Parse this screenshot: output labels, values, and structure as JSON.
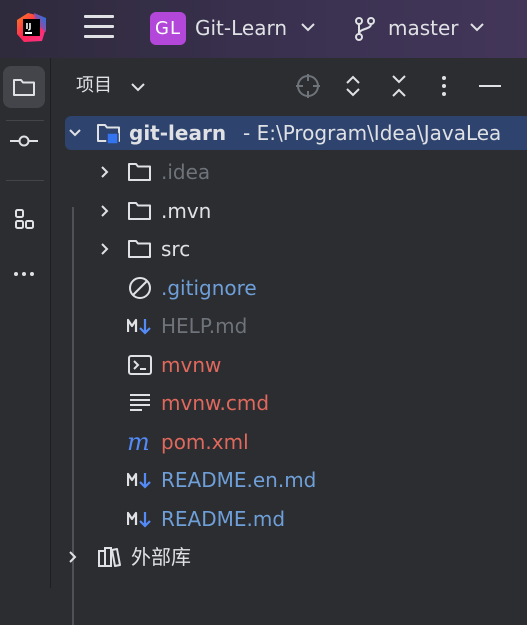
{
  "titlebar": {
    "project_badge": "GL",
    "project_name": "Git-Learn",
    "branch_name": "master"
  },
  "panel": {
    "title": "项目"
  },
  "tree": {
    "root": {
      "name": "git-learn",
      "path": "- E:\\Program\\Idea\\JavaLea"
    },
    "items": [
      {
        "label": ".idea",
        "kind": "folder",
        "color": "#6f737a"
      },
      {
        "label": ".mvn",
        "kind": "folder",
        "color": "#dfe1e5"
      },
      {
        "label": "src",
        "kind": "folder",
        "color": "#dfe1e5"
      },
      {
        "label": ".gitignore",
        "kind": "ignore",
        "color": "#6f9fd8"
      },
      {
        "label": "HELP.md",
        "kind": "markdown",
        "color": "#6f737a"
      },
      {
        "label": "mvnw",
        "kind": "shell",
        "color": "#e0685c"
      },
      {
        "label": "mvnw.cmd",
        "kind": "text",
        "color": "#e0685c"
      },
      {
        "label": "pom.xml",
        "kind": "maven",
        "color": "#e0685c"
      },
      {
        "label": "README.en.md",
        "kind": "markdown",
        "color": "#6f9fd8"
      },
      {
        "label": "README.md",
        "kind": "markdown",
        "color": "#6f9fd8"
      }
    ],
    "external": "外部库"
  },
  "colors": {
    "background": "#2b2d30",
    "selection": "#2e436e",
    "badge": "#b347d9",
    "modified_blue": "#6f9fd8",
    "unversioned_red": "#e0685c",
    "ignored_gray": "#6f737a"
  }
}
